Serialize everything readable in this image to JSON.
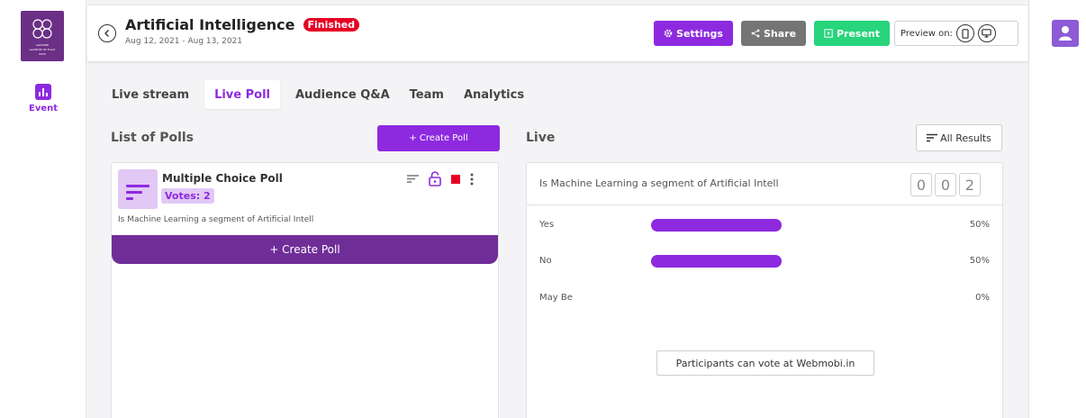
{
  "sidebar": {
    "logo": {
      "line1": "webMOBI",
      "line2": "webMOBI 3D Event",
      "line3": "2020"
    },
    "items": [
      {
        "label": "Event",
        "icon": "bar-chart-icon"
      }
    ]
  },
  "header": {
    "title": "Artificial Intelligence",
    "status": "Finished",
    "date_range": "Aug 12, 2021 - Aug 13, 2021",
    "settings_label": "Settings",
    "share_label": "Share",
    "present_label": "Present",
    "preview_label": "Preview on:"
  },
  "tabs": [
    {
      "label": "Live stream"
    },
    {
      "label": "Live Poll",
      "active": true
    },
    {
      "label": "Audience Q&A"
    },
    {
      "label": "Team"
    },
    {
      "label": "Analytics"
    }
  ],
  "polls": {
    "title": "List of Polls",
    "create_label": "+ Create Poll",
    "create_bar_label": "+ Create Poll",
    "items": [
      {
        "type": "Multiple Choice Poll",
        "votes": "Votes: 2",
        "question": "Is Machine Learning a segment of Artificial Intell"
      }
    ]
  },
  "live": {
    "title": "Live",
    "all_results_label": "All Results",
    "question": "Is Machine Learning a segment of Artificial Intell",
    "vote_digits": [
      "0",
      "0",
      "2"
    ],
    "options": [
      {
        "label": "Yes",
        "percent": "50%",
        "fraction": 0.5
      },
      {
        "label": "No",
        "percent": "50%",
        "fraction": 0.5
      },
      {
        "label": "May Be",
        "percent": "0%",
        "fraction": 0
      }
    ],
    "vote_info": "Participants can vote at Webmobi.in"
  },
  "colors": {
    "accent": "#8d2adf",
    "danger": "#e60023",
    "success": "#28d47c",
    "neutral": "#757575",
    "dark_purple": "#6f2d98"
  }
}
